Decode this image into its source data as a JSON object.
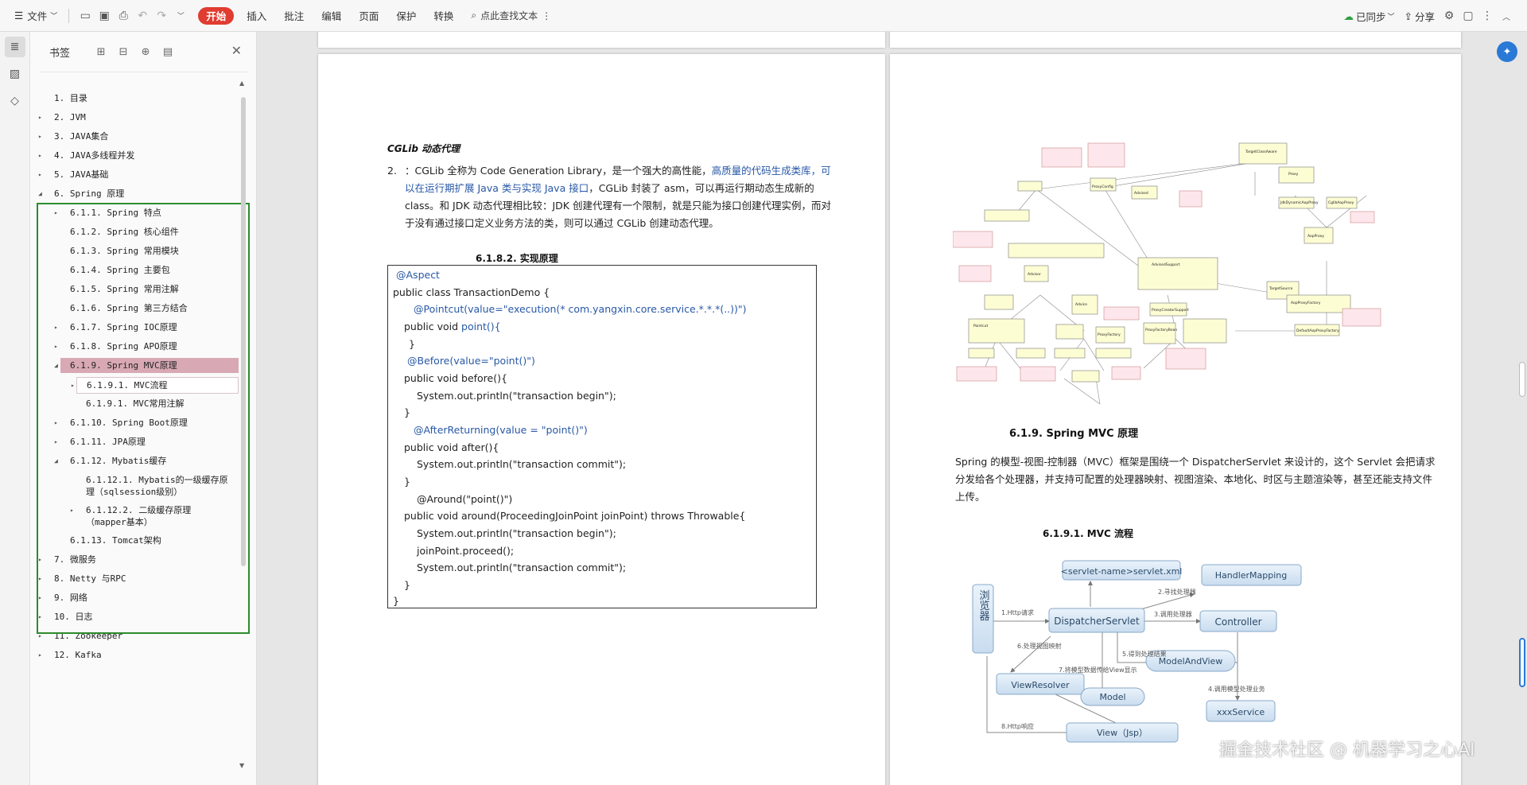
{
  "toolbar": {
    "file_label": "文件",
    "start_label": "开始",
    "menus": [
      "插入",
      "批注",
      "编辑",
      "页面",
      "保护",
      "转换"
    ],
    "search_label": "点此查找文本",
    "sync_label": "已同步",
    "share_label": "分享"
  },
  "panel": {
    "title": "书签",
    "items": [
      {
        "label": "1. 目录"
      },
      {
        "label": "2. JVM"
      },
      {
        "label": "3. JAVA集合"
      },
      {
        "label": "4. JAVA多线程并发"
      },
      {
        "label": "5. JAVA基础"
      },
      {
        "label": "6. Spring 原理"
      },
      {
        "label": "6.1.1. Spring 特点"
      },
      {
        "label": "6.1.2. Spring 核心组件"
      },
      {
        "label": "6.1.3. Spring 常用模块"
      },
      {
        "label": "6.1.4. Spring 主要包"
      },
      {
        "label": "6.1.5. Spring 常用注解"
      },
      {
        "label": "6.1.6. Spring 第三方结合"
      },
      {
        "label": "6.1.7. Spring IOC原理"
      },
      {
        "label": "6.1.8. Spring APO原理"
      },
      {
        "label": "6.1.9. Spring MVC原理"
      },
      {
        "label": "6.1.9.1. MVC流程"
      },
      {
        "label": "6.1.9.1. MVC常用注解"
      },
      {
        "label": "6.1.10. Spring Boot原理"
      },
      {
        "label": "6.1.11. JPA原理"
      },
      {
        "label": "6.1.12. Mybatis缓存"
      },
      {
        "label": "6.1.12.1. Mybatis的一级缓存原理（sqlsession级别）"
      },
      {
        "label": "6.1.12.2. 二级缓存原理（mapper基本）"
      },
      {
        "label": "6.1.13. Tomcat架构"
      },
      {
        "label": "7.   微服务"
      },
      {
        "label": "8. Netty 与RPC"
      },
      {
        "label": "9. 网络"
      },
      {
        "label": "10. 日志"
      },
      {
        "label": "11. Zookeeper"
      },
      {
        "label": "12. Kafka"
      }
    ]
  },
  "left_page": {
    "cglib_heading": "CGLib 动态代理",
    "para_num": "2.",
    "para_part1": "：CGLib 全称为 Code Generation Library，是一个强大的高性能，",
    "para_blue": "高质量的代码生成类库，可以在运行期扩展 Java 类与实现 Java 接口",
    "para_part2": "，CGLib 封装了 asm，可以再运行期动态生成新的 class。和 JDK 动态代理相比较：JDK 创建代理有一个限制，就是只能为接口创建代理实例，而对于没有通过接口定义业务方法的类，则可以通过 CGLib 创建动态代理。",
    "impl_heading": "6.1.8.2.     实现原理",
    "code": [
      "@Aspect",
      "public class TransactionDemo {",
      "@Pointcut(value=\"execution(* com.yangxin.core.service.*.*.*(..))\")",
      "public void ",
      "point(){",
      "}",
      "@Before(value=\"point()\")",
      "public void before(){",
      "System.out.println(\"transaction begin\");",
      "}",
      "@AfterReturning(value = \"point()\")",
      "public void after(){",
      "System.out.println(\"transaction commit\");",
      "}",
      "@Around(\"point()\")",
      "public void around(ProceedingJoinPoint joinPoint) throws Throwable{",
      "System.out.println(\"transaction begin\");",
      "joinPoint.proceed();",
      "System.out.println(\"transaction commit\");",
      "}",
      "}"
    ]
  },
  "right_page": {
    "mvc_heading": "6.1.9. Spring MVC 原理",
    "mvc_para": "Spring 的模型-视图-控制器（MVC）框架是围绕一个 DispatcherServlet 来设计的，这个 Servlet 会把请求分发给各个处理器，并支持可配置的处理器映射、视图渲染、本地化、时区与主题渲染等，甚至还能支持文件上传。",
    "flow_heading": "6.1.9.1.     MVC 流程",
    "flow": {
      "browser": "浏览器",
      "servlet_xml": "<servlet-name>servlet.xml",
      "handler_mapping": "HandlerMapping",
      "dispatcher": "DispatcherServlet",
      "controller": "Controller",
      "model_and_view": "ModelAndView",
      "view_resolver": "ViewResolver",
      "model": "Model",
      "xxx_service": "xxxService",
      "view": "View（Jsp）",
      "e1": "1.Http请求",
      "e2": "2.寻找处理器",
      "e3": "3.调用处理器",
      "e4": "4.调用模型处理业务",
      "e5": "5.得到处理结果",
      "e6": "6.处理视图映射",
      "e7": "7.将模型数据传给View显示",
      "e8": "8.Http响应"
    },
    "uml_labels": {
      "proxy_config": "ProxyConfig",
      "target_class_aware": "TargetClassAware",
      "proxy": "Proxy",
      "advised": "Advised",
      "advised_support": "AdvisedSupport",
      "proxy_creator_support": "ProxyCreatorSupport",
      "proxy_factory": "ProxyFactory",
      "proxy_factory_bean": "ProxyFactoryBean",
      "aop_proxy_factory": "AopProxyFactory",
      "aop_proxy": "AopProxy",
      "target_source": "TargetSource",
      "advisor": "Advisor",
      "advice": "Advice",
      "pointcut": "Pointcut",
      "jdk_proxy": "JdkDynamicAopProxy",
      "cglib_proxy": "CglibAopProxy",
      "default_factory": "DefaultAopProxyFactory"
    }
  },
  "watermark": "掘金技术社区 @ 机器学习之心AI",
  "colors": {
    "accent": "#e03c31",
    "link_blue": "#2858a6",
    "box_green": "#2e8b2e",
    "selected": "#d8a9b4",
    "flow_box": "#d9e8f6"
  }
}
